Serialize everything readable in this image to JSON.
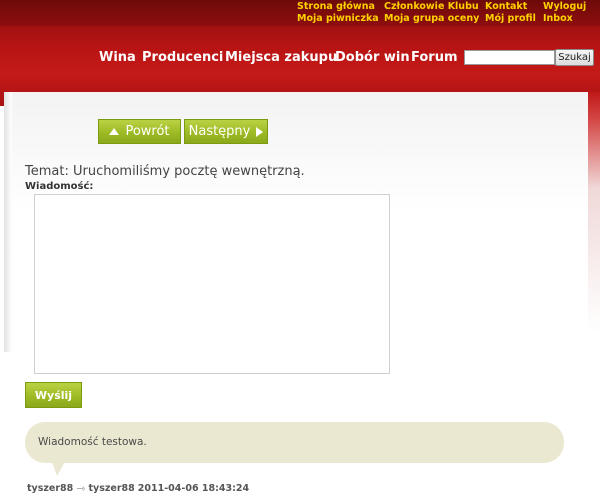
{
  "header": {
    "top_links": {
      "home": "Strona główna",
      "members": "Członkowie Klubu",
      "contact": "Kontakt",
      "logout": "Wyloguj",
      "my_cellar": "Moja piwniczka",
      "my_rating_group": "Moja grupa oceny",
      "my_profile": "Mój profil",
      "inbox": "Inbox"
    },
    "nav": {
      "wines": "Wina",
      "producers": "Producenci",
      "places": "Miejsca zakupu",
      "wine_selection": "Dobór win",
      "forum": "Forum"
    },
    "search": {
      "value": "",
      "button_label": "Szukaj"
    }
  },
  "content": {
    "back_button": "Powrót",
    "next_button": "Następny",
    "subject": "Temat: Uruchomiliśmy pocztę wewnętrzną.",
    "message_label": "Wiadomość:",
    "message_value": "",
    "send_button": "Wyślij",
    "message": {
      "text": "Wiadomość testowa.",
      "from": "tyszer88",
      "to": "tyszer88",
      "timestamp": "2011-04-06 18:43:24"
    }
  },
  "colors": {
    "header_red": "#b81414",
    "top_link_yellow": "#ffd200",
    "button_green": "#9ebb25",
    "bubble_beige": "#ebe8d1"
  },
  "icons": {
    "back": "triangle-up-icon",
    "next": "triangle-right-icon",
    "reply_arrow": "reply-arrow-icon"
  }
}
